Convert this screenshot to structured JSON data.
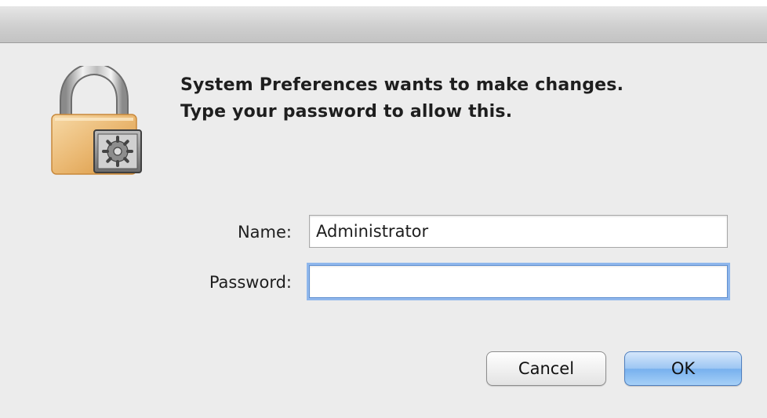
{
  "dialog": {
    "message_line1": "System Preferences wants to make changes.",
    "message_line2": "Type your password to allow this.",
    "lock_icon": "padlock-with-gear-icon"
  },
  "form": {
    "name_label": "Name:",
    "name_value": "Administrator",
    "password_label": "Password:",
    "password_value": ""
  },
  "buttons": {
    "cancel_label": "Cancel",
    "ok_label": "OK"
  },
  "colors": {
    "window_background": "#ececec",
    "focus_ring": "#8fb7ec",
    "default_button": "#77b0ee"
  }
}
